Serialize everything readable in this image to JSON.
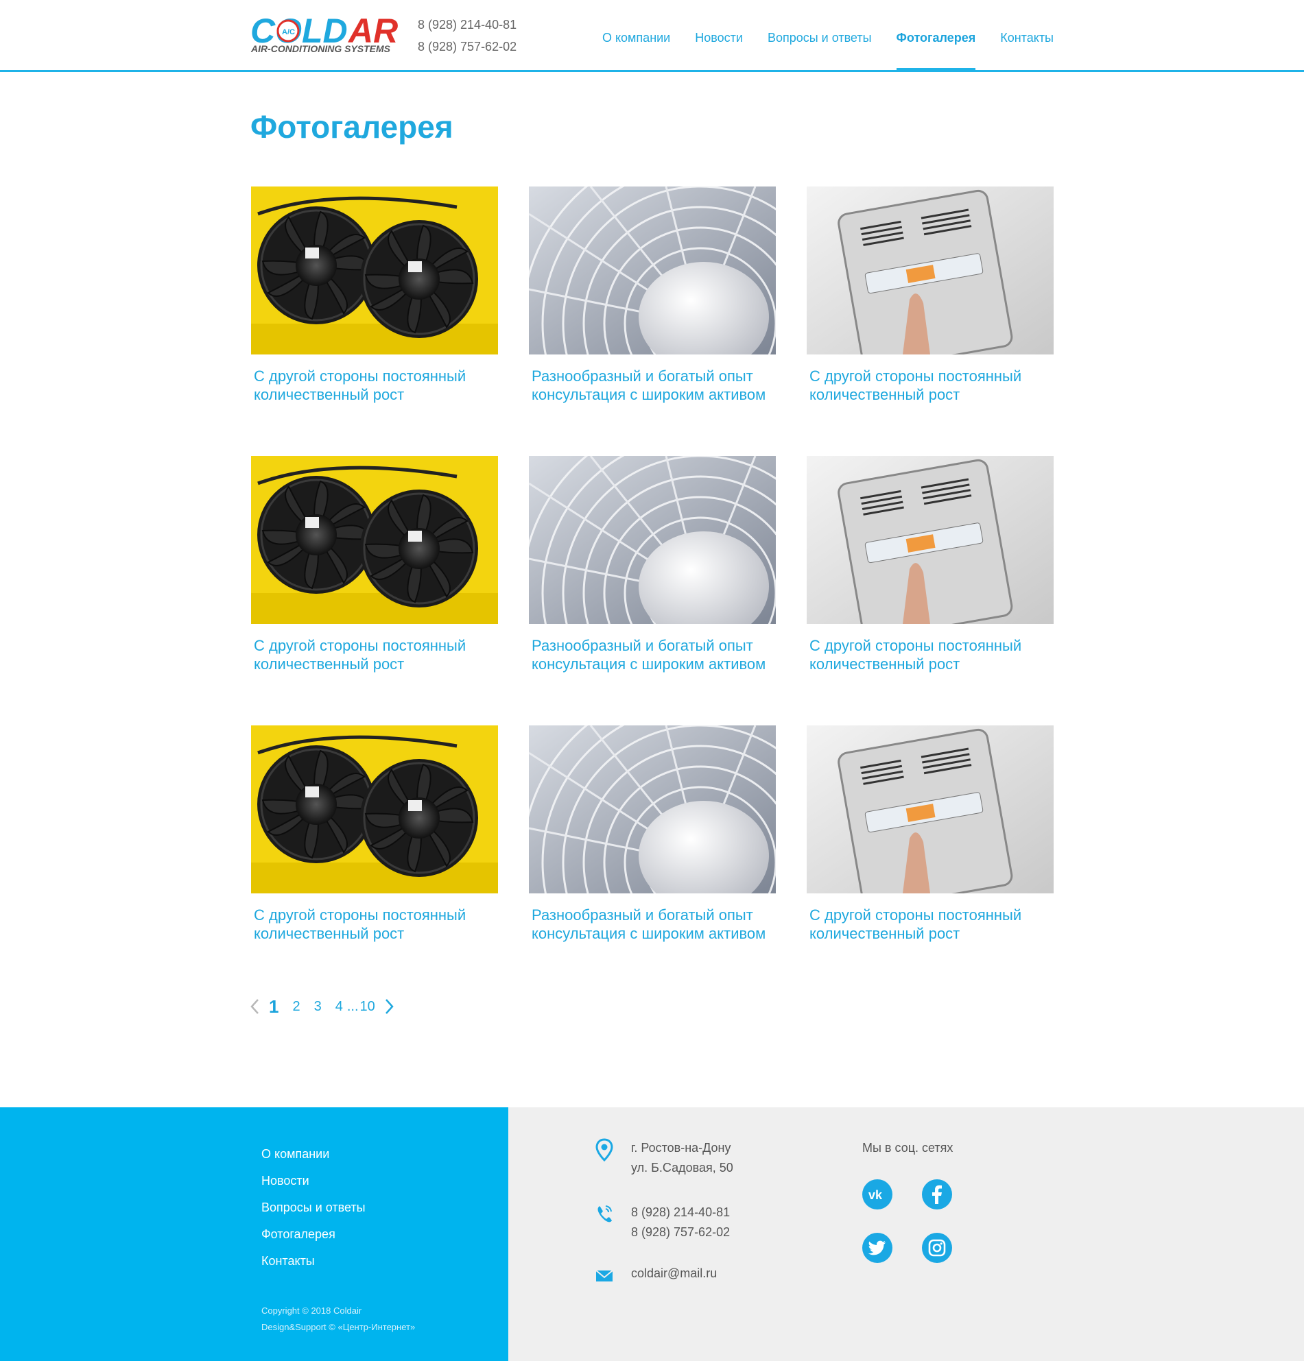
{
  "header": {
    "logo": {
      "word_blue": "COLD",
      "word_red": "AR",
      "badge": "A/C",
      "tagline": "AIR-CONDITIONING SYSTEMS"
    },
    "phones": [
      "8 (928) 214-40-81",
      "8 (928) 757-62-02"
    ],
    "nav": [
      {
        "label": "О компании",
        "active": false
      },
      {
        "label": "Новости",
        "active": false
      },
      {
        "label": "Вопросы и ответы",
        "active": false
      },
      {
        "label": "Фотогалерея",
        "active": true
      },
      {
        "label": "Контакты",
        "active": false
      }
    ]
  },
  "page_title": "Фотогалерея",
  "gallery": [
    {
      "image": "yellow-radiator-fans-photo",
      "caption": "С другой стороны постоянный количественный рост"
    },
    {
      "image": "ac-fan-grille-photo",
      "caption": "Разнообразный и богатый опыт консультация с широким активом"
    },
    {
      "image": "ac-control-panel-photo",
      "caption": "С другой стороны постоянный количественный рост"
    },
    {
      "image": "yellow-radiator-fans-photo",
      "caption": "С другой стороны постоянный количественный рост"
    },
    {
      "image": "ac-fan-grille-photo",
      "caption": "Разнообразный и богатый опыт консультация с широким активом"
    },
    {
      "image": "ac-control-panel-photo",
      "caption": "С другой стороны постоянный количественный рост"
    },
    {
      "image": "yellow-radiator-fans-photo",
      "caption": "С другой стороны постоянный количественный рост"
    },
    {
      "image": "ac-fan-grille-photo",
      "caption": "Разнообразный и богатый опыт консультация с широким активом"
    },
    {
      "image": "ac-control-panel-photo",
      "caption": "С другой стороны постоянный количественный рост"
    }
  ],
  "pagination": {
    "prev_icon": "chevron-left-icon",
    "next_icon": "chevron-right-icon",
    "current": "1",
    "pages": [
      "2",
      "3",
      "4"
    ],
    "ellipsis": "...",
    "last": "10"
  },
  "footer": {
    "nav": [
      "О компании",
      "Новости",
      "Вопросы и ответы",
      "Фотогалерея",
      "Контакты"
    ],
    "copyright": "Copyright © 2018 Coldair",
    "support": "Design&Support © «Центр-Интернет»",
    "address_line1": "г. Ростов-на-Дону",
    "address_line2": "ул. Б.Садовая, 50",
    "phone1": "8 (928) 214-40-81",
    "phone2": "8 (928) 757-62-02",
    "email": "coldair@mail.ru",
    "social_title": "Мы в соц. сетях",
    "social_icons": [
      "vk-icon",
      "facebook-icon",
      "twitter-icon",
      "instagram-icon"
    ]
  },
  "colors": {
    "accent": "#1FA8DE",
    "accent_bright": "#00B4EE",
    "logo_red": "#E0312A",
    "footer_gray": "#EFEFEF"
  }
}
